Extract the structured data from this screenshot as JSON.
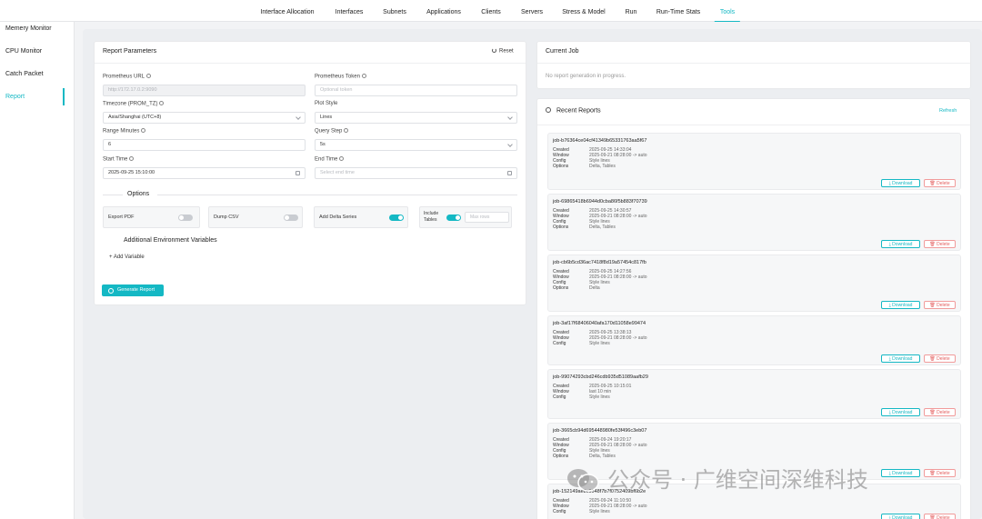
{
  "nav": {
    "tabs": [
      "Interface Allocation",
      "Interfaces",
      "Subnets",
      "Applications",
      "Clients",
      "Servers",
      "Stress & Model",
      "Run",
      "Run-Time Stats",
      "Tools"
    ],
    "active": "Tools"
  },
  "sidebar": {
    "items": [
      "Memery Monitor",
      "CPU Monitor",
      "Catch Packet",
      "Report"
    ],
    "active": "Report"
  },
  "report_params": {
    "title": "Report Parameters",
    "reset_label": "Reset",
    "prometheus_url": {
      "label": "Prometheus URL",
      "placeholder": "http://172.17.0.2:9090"
    },
    "prometheus_token": {
      "label": "Prometheus Token",
      "placeholder": "Optional token"
    },
    "timezone": {
      "label": "Timezone (PROM_TZ)",
      "value": "Asia/Shanghai (UTC+8)"
    },
    "plot_style": {
      "label": "Plot Style",
      "value": "Lines"
    },
    "range_minutes": {
      "label": "Range Minutes",
      "value": "6"
    },
    "query_step": {
      "label": "Query Step",
      "value": "5s"
    },
    "start_time": {
      "label": "Start Time",
      "value": "2025-09-25 15:10:00"
    },
    "end_time": {
      "label": "End Time",
      "placeholder": "Select end time"
    },
    "options_title": "Options",
    "options": {
      "export_pdf": {
        "label": "Export PDF",
        "on": false
      },
      "dump_csv": {
        "label": "Dump CSV",
        "on": false
      },
      "add_delta": {
        "label": "Add Delta Series",
        "on": true
      },
      "include_tables": {
        "label_line1": "Include",
        "label_line2": "Tables",
        "on": true,
        "max_rows_placeholder": "Max rows"
      }
    },
    "env_title": "Additional Environment Variables",
    "add_variable": "+  Add Variable",
    "generate": "Generate Report"
  },
  "current_job": {
    "title": "Current Job",
    "status": "No report generation in progress."
  },
  "recent_reports": {
    "title": "Recent Reports",
    "refresh": "Refresh",
    "download_label": "Download",
    "delete_label": "Delete",
    "keys": {
      "created": "Created",
      "window": "Window",
      "config": "Config",
      "options": "Options"
    },
    "items": [
      {
        "id": "job-b76364ce04cf41349b65331763aa5f67",
        "created": "2025-09-25 14:33:04",
        "window": "2025-09-21 08:28:00 -> auto",
        "config": "Style lines",
        "options": "Delta, Tables"
      },
      {
        "id": "job-69865418b6944d0cba86f5b883f70739",
        "created": "2025-09-25 14:30:57",
        "window": "2025-09-21 08:28:00 -> auto",
        "config": "Style lines",
        "options": "Delta, Tables"
      },
      {
        "id": "job-cb6b5cd36ac7418f8d19a57454c817fb",
        "created": "2025-09-25 14:27:56",
        "window": "2025-09-21 08:28:00 -> auto",
        "config": "Style lines",
        "options": "Delta"
      },
      {
        "id": "job-3af17f68406040afa170d11058e99474",
        "created": "2025-09-25 13:38:13",
        "window": "2025-09-21 08:28:00 -> auto",
        "config": "Style lines",
        "options": null
      },
      {
        "id": "job-99074293cbd246cdb935d51089aafb29",
        "created": "2025-09-25 10:15:01",
        "window": "last 10 min",
        "config": "Style lines",
        "options": null
      },
      {
        "id": "job-3665cb94d695448980fe53f496c3eb07",
        "created": "2025-09-24 19:20:17",
        "window": "2025-09-21 08:28:00 -> auto",
        "config": "Style lines",
        "options": "Delta, Tables"
      },
      {
        "id": "job-152149ae8c9548f7b7f0752409bf6b2e",
        "created": "2025-09-24 11:10:50",
        "window": "2025-09-21 08:28:00 -> auto",
        "config": "Style lines",
        "options": null
      }
    ]
  },
  "watermark": {
    "text": "公众号 · 广维空间深维科技"
  },
  "colors": {
    "accent": "#14b8c4",
    "danger": "#e35d5d"
  }
}
